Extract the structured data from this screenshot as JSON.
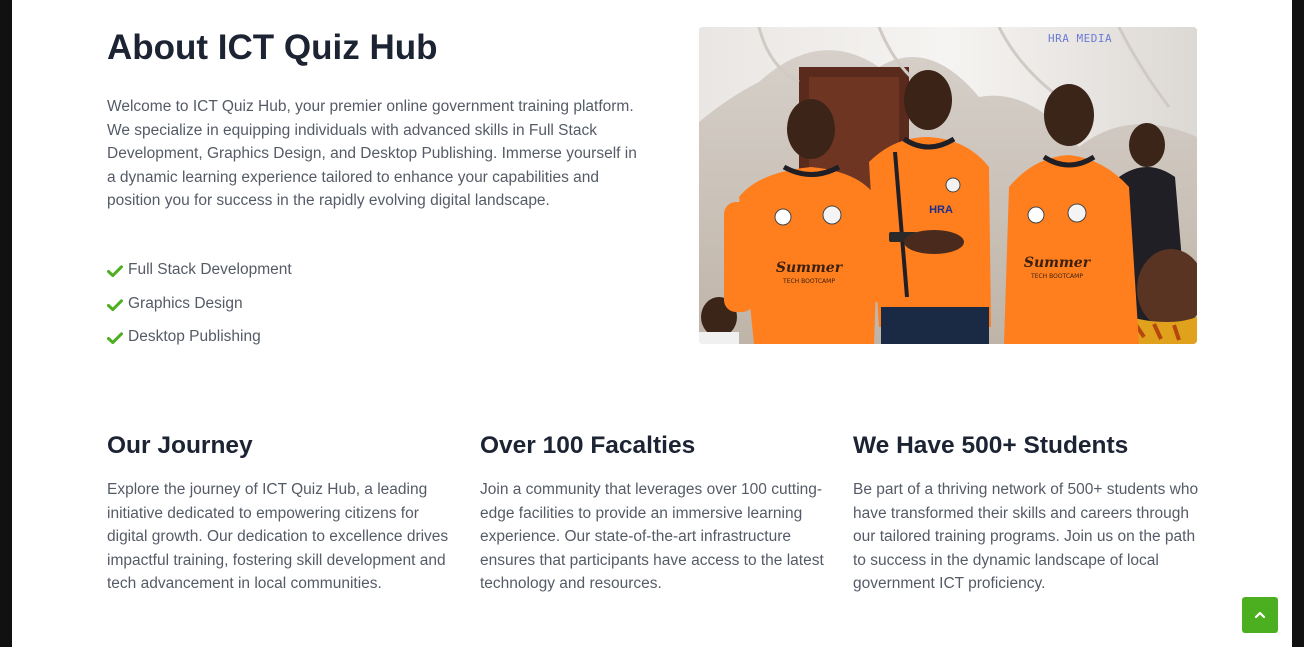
{
  "about": {
    "title": "About ICT Quiz Hub",
    "body": "Welcome to ICT Quiz Hub, your premier online government training platform. We specialize in equipping individuals with advanced skills in Full Stack Development, Graphics Design, and Desktop Publishing. Immerse yourself in a dynamic learning experience tailored to enhance your capabilities and position you for success in the rapidly evolving digital landscape.",
    "checklist": [
      "Full Stack Development",
      "Graphics Design",
      "Desktop Publishing"
    ],
    "photo": {
      "watermark": "HRA MEDIA",
      "shirt_text": "Summer",
      "shirt_subtext": "TECH BOOTCAMP",
      "badge_text": "HRA"
    }
  },
  "features": [
    {
      "title": "Our Journey",
      "body": "Explore the journey of ICT Quiz Hub, a leading initiative dedicated to empowering citizens for digital growth. Our dedication to excellence drives impactful training, fostering skill development and tech advancement in local communities."
    },
    {
      "title": "Over 100 Facalties",
      "body": "Join a community that leverages over 100 cutting-edge facilities to provide an immersive learning experience. Our state-of-the-art infrastructure ensures that participants have access to the latest technology and resources."
    },
    {
      "title": "We Have 500+ Students",
      "body": "Be part of a thriving network of 500+ students who have transformed their skills and careers through our tailored training programs. Join us on the path to success in the dynamic landscape of local government ICT proficiency."
    }
  ],
  "icons": {
    "check": "check-icon",
    "back_to_top": "chevron-up-icon"
  },
  "colors": {
    "accent_green": "#4caf1f",
    "heading": "#1c2333",
    "body_text": "#555b66",
    "shirt_orange": "#ff7f1f"
  }
}
